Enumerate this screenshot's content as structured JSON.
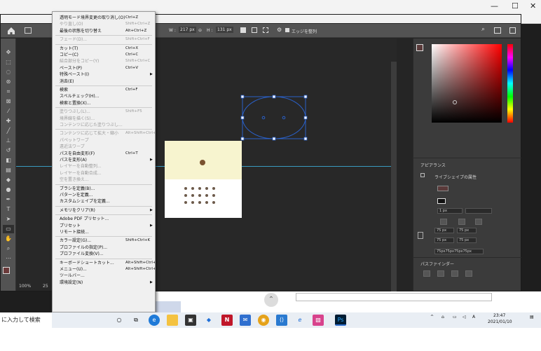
{
  "photoshop": {
    "options_bar": {
      "w_label": "W :",
      "w_value": "217 px",
      "h_label": "H :",
      "h_value": "131 px",
      "auto_label": "エッジを整列"
    },
    "status": {
      "zoom": "100%",
      "doc_info": "25"
    }
  },
  "edit_menu": {
    "items": [
      {
        "label": "透明モード境界変更の取り消し(O)",
        "shortcut": "Ctrl+Z",
        "disabled": false
      },
      {
        "label": "やり直し(O)",
        "shortcut": "Shift+Ctrl+Z",
        "disabled": true
      },
      {
        "label": "最後の状態を切り替え",
        "shortcut": "Alt+Ctrl+Z",
        "disabled": false
      },
      {
        "sep": true
      },
      {
        "label": "フェード(D)...",
        "shortcut": "Shift+Ctrl+F",
        "disabled": true
      },
      {
        "sep": true
      },
      {
        "label": "カット(T)",
        "shortcut": "Ctrl+X",
        "disabled": false
      },
      {
        "label": "コピー(C)",
        "shortcut": "Ctrl+C",
        "disabled": false
      },
      {
        "label": "結合部分をコピー(Y)",
        "shortcut": "Shift+Ctrl+C",
        "disabled": true
      },
      {
        "label": "ペースト(P)",
        "shortcut": "Ctrl+V",
        "disabled": false
      },
      {
        "label": "特殊ペースト(I)",
        "shortcut": "",
        "arrow": true,
        "disabled": false
      },
      {
        "label": "消去(E)",
        "shortcut": "",
        "disabled": false
      },
      {
        "sep": true
      },
      {
        "label": "検索",
        "shortcut": "Ctrl+F",
        "disabled": false
      },
      {
        "label": "スペルチェック(H)...",
        "shortcut": "",
        "disabled": false
      },
      {
        "label": "検索と置換(X)...",
        "shortcut": "",
        "disabled": false
      },
      {
        "sep": true
      },
      {
        "label": "塗りつぶし(L)...",
        "shortcut": "Shift+F5",
        "disabled": true
      },
      {
        "label": "境界線を描く(S)...",
        "shortcut": "",
        "disabled": true
      },
      {
        "label": "コンテンツに応じた塗りつぶし...",
        "shortcut": "",
        "disabled": true
      },
      {
        "sep": true
      },
      {
        "label": "コンテンツに応じて拡大・縮小",
        "shortcut": "Alt+Shift+Ctrl+C",
        "disabled": true
      },
      {
        "label": "パペットワープ",
        "shortcut": "",
        "disabled": true
      },
      {
        "label": "遠近法ワープ",
        "shortcut": "",
        "disabled": true
      },
      {
        "label": "パスを自由変形(F)",
        "shortcut": "Ctrl+T",
        "disabled": false
      },
      {
        "label": "パスを変形(A)",
        "shortcut": "",
        "arrow": true,
        "disabled": false
      },
      {
        "label": "レイヤーを自動整列...",
        "shortcut": "",
        "disabled": true
      },
      {
        "label": "レイヤーを自動合成...",
        "shortcut": "",
        "disabled": true
      },
      {
        "label": "空を置き換え...",
        "shortcut": "",
        "disabled": true
      },
      {
        "sep": true
      },
      {
        "label": "ブラシを定義(B)...",
        "shortcut": "",
        "disabled": false
      },
      {
        "label": "パターンを定義...",
        "shortcut": "",
        "disabled": false
      },
      {
        "label": "カスタムシェイプを定義...",
        "shortcut": "",
        "disabled": false
      },
      {
        "sep": true
      },
      {
        "label": "メモリをクリア(R)",
        "shortcut": "",
        "arrow": true,
        "disabled": false
      },
      {
        "sep": true
      },
      {
        "label": "Adobe PDF プリセット...",
        "shortcut": "",
        "disabled": false
      },
      {
        "label": "プリセット",
        "shortcut": "",
        "arrow": true,
        "disabled": false
      },
      {
        "label": "リモート接続...",
        "shortcut": "",
        "disabled": false
      },
      {
        "sep": true
      },
      {
        "label": "カラー設定(G)...",
        "shortcut": "Shift+Ctrl+K",
        "disabled": false
      },
      {
        "label": "プロファイルの指定(P)...",
        "shortcut": "",
        "disabled": false
      },
      {
        "label": "プロファイル変換(V)...",
        "shortcut": "",
        "disabled": false
      },
      {
        "sep": true
      },
      {
        "label": "キーボードショートカット...",
        "shortcut": "Alt+Shift+Ctrl+K",
        "disabled": false
      },
      {
        "label": "メニュー(U)...",
        "shortcut": "Alt+Shift+Ctrl+M",
        "disabled": false
      },
      {
        "label": "ツールバー...",
        "shortcut": "",
        "disabled": false
      },
      {
        "label": "環境設定(N)",
        "shortcut": "",
        "arrow": true,
        "disabled": false
      }
    ]
  },
  "properties_panel": {
    "appearance_title": "アピアランス",
    "shape_props": "ライブシェイプの属性",
    "stroke_width": "1 px",
    "corner_tl": "75 px",
    "corner_tr": "75 px",
    "corner_bl": "75 px",
    "corner_br": "75 px",
    "corners_summary": "75px75px75px75px",
    "pathfinder_title": "パスファインダー"
  },
  "colors": {
    "accent_guide": "#3a9ac0",
    "selection": "#2a60c8"
  },
  "taskbar": {
    "search_placeholder": "に入力して検索",
    "time": "23:47",
    "date": "2021/01/10",
    "ime": "A"
  }
}
